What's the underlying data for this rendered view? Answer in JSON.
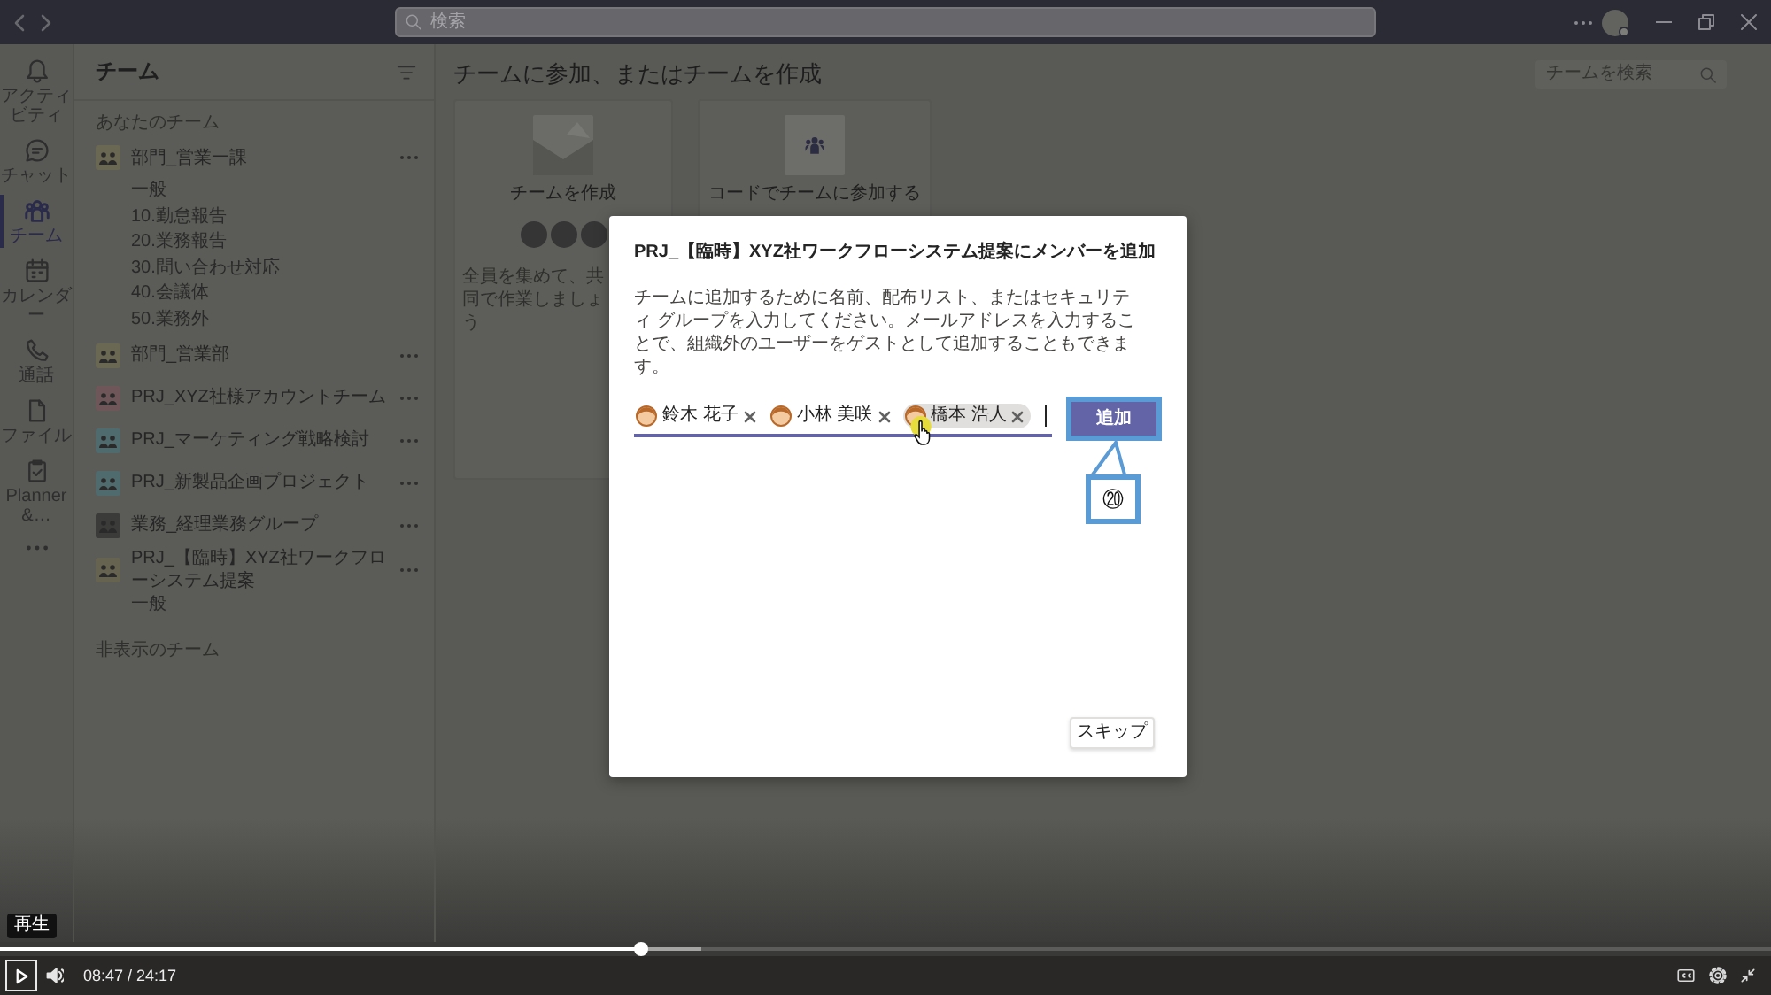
{
  "title_bar": {
    "search": {
      "placeholder": "検索"
    }
  },
  "app_bar": {
    "items": [
      {
        "label": "アクティビティ",
        "selected": false
      },
      {
        "label": "チャット",
        "selected": false
      },
      {
        "label": "チーム",
        "selected": true
      },
      {
        "label": "カレンダー",
        "selected": false
      },
      {
        "label": "通話",
        "selected": false
      },
      {
        "label": "ファイル",
        "selected": false
      },
      {
        "label": "Planner &…",
        "selected": false
      }
    ]
  },
  "sidebar": {
    "title": "チーム",
    "section_label": "あなたのチーム",
    "teams": [
      {
        "name": "部門_営業一課",
        "color": "#6a6852",
        "channels": [
          "一般",
          "10.勤怠報告",
          "20.業務報告",
          "30.問い合わせ対応",
          "40.会議体",
          "50.業務外"
        ]
      },
      {
        "name": "部門_営業部",
        "color": "#6a6852"
      },
      {
        "name": "PRJ_XYZ社様アカウントチーム",
        "color": "#6e5659"
      },
      {
        "name": "PRJ_マーケティング戦略検討",
        "color": "#4f6b6d"
      },
      {
        "name": "PRJ_新製品企画プロジェクト",
        "color": "#4f6b6d"
      },
      {
        "name": "業務_経理業務グループ",
        "color": "#3b3b3a"
      },
      {
        "name": "PRJ_【臨時】XYZ社ワークフローシステム提案",
        "color": "#666450",
        "channels": [
          "一般"
        ]
      }
    ],
    "hidden_label": "非表示のチーム"
  },
  "main": {
    "heading": "チームに参加、またはチームを作成",
    "search": {
      "placeholder": "チームを検索"
    },
    "cards": [
      {
        "kind": "create",
        "title": "チームを作成",
        "description": "全員を集めて、共同で作業しましょう"
      },
      {
        "kind": "code",
        "title": "コードでチームに参加する"
      }
    ]
  },
  "dialog": {
    "title": "PRJ_【臨時】XYZ社ワークフローシステム提案にメンバーを追加",
    "description": "チームに追加するために名前、配布リスト、またはセキュリティ グループを入力してください。メールアドレスを入力することで、組織外のユーザーをゲストとして追加することもできます。",
    "chips": [
      {
        "name": "鈴木 花子",
        "selected": false
      },
      {
        "name": "小林 美咲",
        "selected": false
      },
      {
        "name": "橋本 浩人",
        "selected": true
      }
    ],
    "add_button": "追加",
    "skip_button": "スキップ"
  },
  "annotation": {
    "callout": "⑳"
  },
  "player": {
    "tooltip": "再生",
    "progress": {
      "level": 0.362
    },
    "time": "08:47 / 24:17"
  }
}
